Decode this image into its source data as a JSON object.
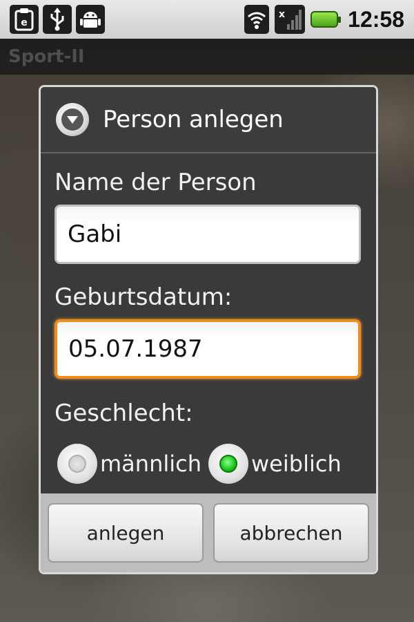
{
  "status_bar": {
    "time": "12:58",
    "left_icons": [
      "clipboard-icon",
      "usb-icon",
      "android-debug-icon"
    ],
    "right_icons": [
      "wifi-icon",
      "signal-icon",
      "battery-icon"
    ]
  },
  "app": {
    "title": "Sport-II"
  },
  "dialog": {
    "title": "Person anlegen",
    "name_label": "Name der Person",
    "name_value": "Gabi",
    "birthdate_label": "Geburtsdatum:",
    "birthdate_value": "05.07.1987",
    "gender_label": "Geschlecht:",
    "gender_options": [
      {
        "label": "männlich",
        "checked": false
      },
      {
        "label": "weiblich",
        "checked": true
      }
    ],
    "create_button": "anlegen",
    "cancel_button": "abbrechen"
  },
  "colors": {
    "focus_border": "#f08b1d",
    "radio_checked": "#19c419",
    "battery": "#4aa41a"
  }
}
